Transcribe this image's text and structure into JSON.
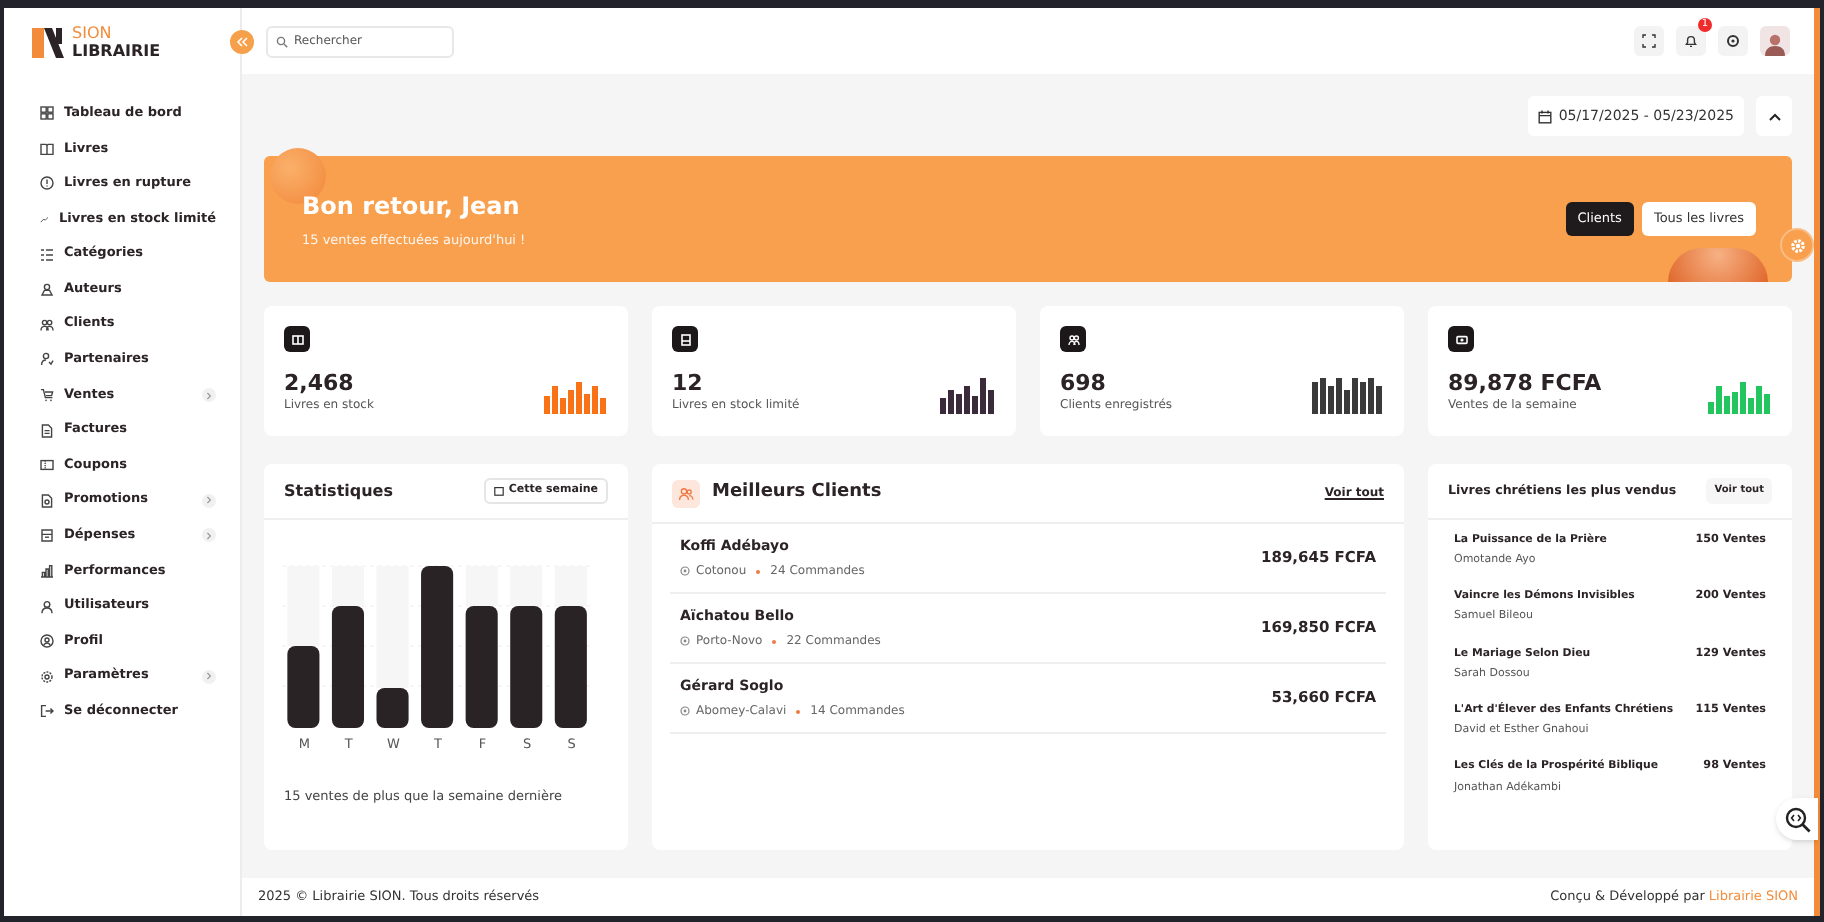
{
  "header": {
    "logo": {
      "line_1": "SION",
      "line_2": "LIBRAIRIE"
    },
    "search": {
      "placeholder": "Rechercher"
    },
    "notification_count": "1"
  },
  "sidebar": {
    "items": [
      {
        "label": "Tableau de bord",
        "expandable": false
      },
      {
        "label": "Livres",
        "expandable": false
      },
      {
        "label": "Livres en rupture",
        "expandable": false
      },
      {
        "label": "Livres en stock limité",
        "expandable": false
      },
      {
        "label": "Catégories",
        "expandable": false
      },
      {
        "label": "Auteurs",
        "expandable": false
      },
      {
        "label": "Clients",
        "expandable": false
      },
      {
        "label": "Partenaires",
        "expandable": false
      },
      {
        "label": "Ventes",
        "expandable": true
      },
      {
        "label": "Factures",
        "expandable": false
      },
      {
        "label": "Coupons",
        "expandable": false
      },
      {
        "label": "Promotions",
        "expandable": true
      },
      {
        "label": "Dépenses",
        "expandable": true
      },
      {
        "label": "Performances",
        "expandable": false
      },
      {
        "label": "Utilisateurs",
        "expandable": false
      },
      {
        "label": "Profil",
        "expandable": false
      },
      {
        "label": "Paramètres",
        "expandable": true
      },
      {
        "label": "Se déconnecter",
        "expandable": false
      }
    ]
  },
  "date_range": "05/17/2025 - 05/23/2025",
  "banner": {
    "title": "Bon retour, Jean",
    "subtitle": "15 ventes effectuées aujourd'hui !",
    "buttons": [
      {
        "label": "Clients",
        "selected": true
      },
      {
        "label": "Tous les livres",
        "selected": false
      }
    ]
  },
  "stats": [
    {
      "value": "2,468",
      "label": "Livres en stock",
      "color": "#f97316"
    },
    {
      "value": "12",
      "label": "Livres en stock limité",
      "color": "#3b2a3a"
    },
    {
      "value": "698",
      "label": "Clients enregistrés",
      "color": "#3a3a3a"
    },
    {
      "value": "89,878 FCFA",
      "label": "Ventes de la semaine",
      "color": "#22c55e"
    }
  ],
  "statistics": {
    "title": "Statistiques",
    "filter": "Cette semaine",
    "days": [
      "M",
      "T",
      "W",
      "T",
      "F",
      "S",
      "S"
    ],
    "note": "15 ventes de plus que la semaine dernière"
  },
  "top_clients": {
    "title": "Meilleurs Clients",
    "link": "Voir tout",
    "rows": [
      {
        "name": "Koffi Adébayo",
        "city": "Cotonou",
        "orders": "24 Commandes",
        "amount": "189,645 FCFA"
      },
      {
        "name": "Aïchatou Bello",
        "city": "Porto-Novo",
        "orders": "22 Commandes",
        "amount": "169,850 FCFA"
      },
      {
        "name": "Gérard Soglo",
        "city": "Abomey-Calavi",
        "orders": "14 Commandes",
        "amount": "53,660 FCFA"
      }
    ]
  },
  "bestsellers": {
    "title": "Livres chrétiens les plus vendus",
    "button": "Voir tout",
    "rows": [
      {
        "title": "La Puissance de la Prière",
        "author": "Omotande Ayo",
        "sales": "150 Ventes"
      },
      {
        "title": "Vaincre les Démons Invisibles",
        "author": "Samuel Bileou",
        "sales": "200 Ventes"
      },
      {
        "title": "Le Mariage Selon Dieu",
        "author": "Sarah Dossou",
        "sales": "129 Ventes"
      },
      {
        "title": "L'Art d'Élever des Enfants Chrétiens",
        "author": "David et Esther Gnahoui",
        "sales": "115 Ventes"
      },
      {
        "title": "Les Clés de la Prospérité Biblique",
        "author": "Jonathan Adékambi",
        "sales": "98 Ventes"
      }
    ]
  },
  "footer": {
    "copyright": "2025 © Librairie SION. Tous droits réservés",
    "credit": "Conçu & Développé par",
    "credit_link": "Librairie SION"
  }
}
